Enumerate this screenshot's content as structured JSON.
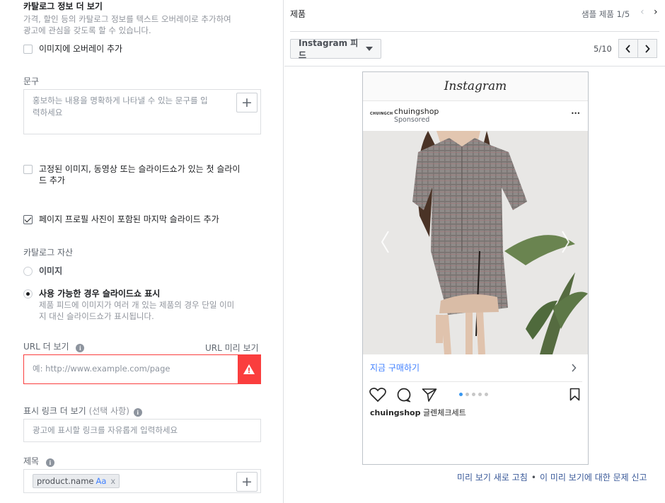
{
  "left": {
    "catalog_more_title": "카탈로그 정보 더 보기",
    "catalog_more_desc_line1": "가격, 할인 등의 카탈로그 정보를 텍스트 오버레이로 추가하여",
    "catalog_more_desc_line2": "광고에 관심을 갖도록 할 수 있습니다.",
    "overlay_checkbox_label": "이미지에 오버레이 추가",
    "text_section_label": "문구",
    "text_placeholder_line1": "홍보하는 내용을 명확하게 나타낼 수 있는 문구를 입",
    "text_placeholder_line2": "력하세요",
    "fixed_media_label_line1": "고정된 이미지, 동영상 또는 슬라이드쇼가 있는 첫 슬라이",
    "fixed_media_label_line2": "드 추가",
    "profile_slide_label": "페이지 프로필 사진이 포함된 마지막 슬라이드 추가",
    "catalog_assets_label": "카탈로그 자산",
    "radio_image_label": "이미지",
    "radio_slideshow_label": "사용 가능한 경우 슬라이드쇼 표시",
    "radio_slideshow_desc_line1": "제품 피드에 이미지가 여러 개 있는 제품의 경우 단일 이미",
    "radio_slideshow_desc_line2": "지 대신 슬라이드쇼가 표시됩니다.",
    "url_more_label": "URL 더 보기",
    "url_preview_link": "URL 미리 보기",
    "url_placeholder": "예: http://www.example.com/page",
    "display_link_label": "표시 링크 더 보기",
    "display_link_optional": "(선택 사항)",
    "display_link_placeholder": "광고에 표시할 링크를 자유롭게 입력하세요",
    "headline_label": "제목",
    "headline_tag": "product.name",
    "headline_tag_aa": "Aa",
    "headline_tag_x": "x",
    "plus": "+",
    "warning_glyph": "!",
    "info_glyph": "i"
  },
  "right": {
    "product_label": "제품",
    "sample_product": "샘플 제품 1/5",
    "placement_dropdown": "Instagram 피드",
    "pager": "5/10",
    "preview": {
      "app_name": "Instagram",
      "account_logo_text": "CHUINGCH",
      "account_name": "chuingshop",
      "sponsored": "Sponsored",
      "more_glyph": "•••",
      "cta_label": "지금 구매하기",
      "caption_user": "chuingshop",
      "caption_text": "글렌체크세트",
      "dots_active_index": 0,
      "dots_count": 5
    },
    "footer_refresh": "미리 보기 새로 고침",
    "footer_sep": "•",
    "footer_report": "이 미리 보기에 대한 문제 신고"
  },
  "colors": {
    "accent_blue": "#4080ff",
    "warning_red": "#fa3e3e",
    "link_blue": "#385898"
  }
}
